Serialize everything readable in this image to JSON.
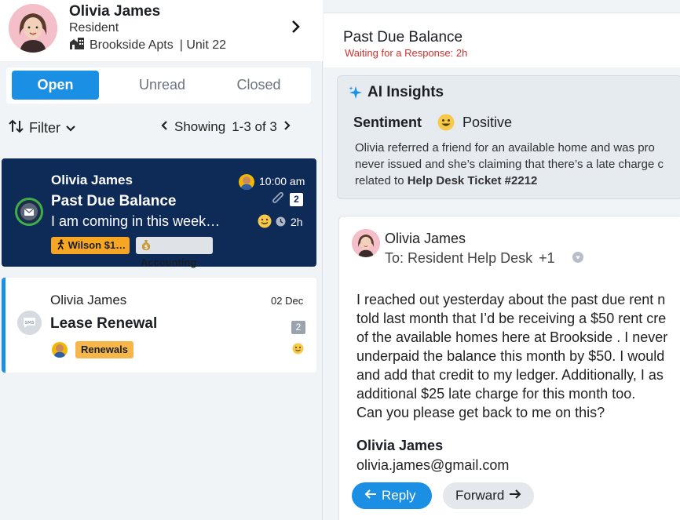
{
  "resident": {
    "name": "Olivia James",
    "role": "Resident",
    "property": "Brookside Apts",
    "unit": "| Unit 22"
  },
  "tabs": [
    {
      "label": "Open",
      "active": true
    },
    {
      "label": "Unread",
      "active": false
    },
    {
      "label": "Closed",
      "active": false
    }
  ],
  "toolbar": {
    "filter_label": "Filter",
    "showing_label": "Showing",
    "showing_range": "1-3 of 3"
  },
  "conversations": [
    {
      "sender": "Olivia James",
      "time": "10:00 am",
      "subject": "Past Due Balance",
      "preview": "I am coming in this week…",
      "attachments": "2",
      "elapsed": "2h",
      "tags": [
        "Wilson $1…",
        "Accounting"
      ],
      "selected": true
    },
    {
      "sender": "Olivia James",
      "time": "02 Dec",
      "subject": "Lease Renewal",
      "count": "2",
      "tags": [
        "Renewals"
      ],
      "selected": false
    }
  ],
  "thread": {
    "title": "Past Due Balance",
    "status": "Waiting for a Response: 2h"
  },
  "ai_insights": {
    "title": "AI Insights",
    "sentiment_label": "Sentiment",
    "sentiment_value": "Positive",
    "summary_line1": "Olivia referred a friend for an available home and was pro",
    "summary_line2": "never issued and she’s claiming that there’s a late charge c",
    "summary_line3_prefix": "related to ",
    "summary_ticket": "Help Desk Ticket #2212"
  },
  "email": {
    "from": "Olivia James",
    "to": "To: Resident Help Desk",
    "to_extra": "+1",
    "body_lines": [
      "I reached out yesterday about the past due rent n",
      "told last month that I’d be receiving a $50 rent cre",
      "of the available homes here at Brookside . I never",
      "underpaid the balance this month by $50. I would",
      "and add that credit to my ledger. Additionally, I as",
      "additional $25 late charge for this month too.",
      "Can you please get back to me on this?"
    ],
    "signature_name": "Olivia James",
    "signature_email": "olivia.james@gmail.com",
    "reply_label": "Reply",
    "forward_label": "Forward"
  },
  "colors": {
    "accent": "#1a8fe3",
    "selected_card": "#0e2a57",
    "status_red": "#d0312d",
    "tag_orange": "#f6a623",
    "online_green": "#3fae49"
  }
}
